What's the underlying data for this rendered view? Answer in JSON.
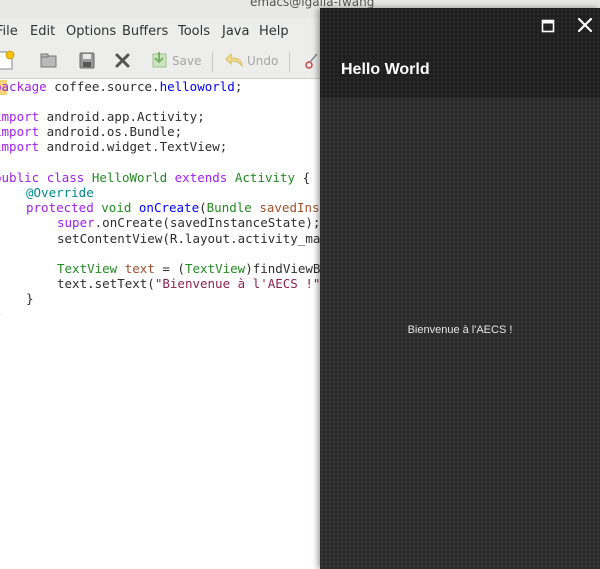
{
  "emacs": {
    "title": "emacs@igalia-fwang",
    "menu": [
      "File",
      "Edit",
      "Options",
      "Buffers",
      "Tools",
      "Java",
      "Help"
    ],
    "toolbar": {
      "save_label": "Save",
      "undo_label": "Undo",
      "icons": [
        "new-file-icon",
        "open-folder-icon",
        "save-disk-icon",
        "close-x-icon",
        "save-icon",
        "undo-icon",
        "cut-icon"
      ]
    },
    "code": {
      "line1": {
        "a": "package",
        "b": " coffee.source.",
        "c": "helloworld",
        "d": ";"
      },
      "line2": {
        "a": "import",
        "b": " android.app.Activity;"
      },
      "line3": {
        "a": "import",
        "b": " android.os.Bundle;"
      },
      "line4": {
        "a": "import",
        "b": " android.widget.TextView;"
      },
      "line5": {
        "a": "public",
        "b": " ",
        "c": "class",
        "d": " ",
        "e": "HelloWorld",
        "f": " ",
        "g": "extends",
        "h": " ",
        "i": "Activity",
        "j": " {"
      },
      "line6": {
        "a": "@Override"
      },
      "line7": {
        "a": "protected",
        "b": " ",
        "c": "void",
        "d": " ",
        "e": "onCreate",
        "f": "(",
        "g": "Bundle",
        "h": " ",
        "i": "savedIns"
      },
      "line8": {
        "a": "super",
        "b": ".onCreate(savedInstanceState);"
      },
      "line9": {
        "a": "setContentView(R.layout.activity_ma"
      },
      "line10": {
        "a": "TextView",
        "b": " ",
        "c": "text",
        "d": " = (",
        "e": "TextView",
        "f": ")findViewB"
      },
      "line11": {
        "a": "text.setText(",
        "b": "\"Bienvenue à l'AECS !\""
      },
      "line12": {
        "a": "}"
      },
      "line13": {
        "a": "}"
      }
    }
  },
  "emulator": {
    "app_title": "Hello World",
    "body_text": "Bienvenue à l'AECS !",
    "icons": [
      "maximize-icon",
      "close-icon"
    ]
  },
  "colors": {
    "keyword": "#a020f0",
    "type": "#228b22",
    "function": "#0000ff",
    "variable": "#a0522d",
    "string": "#8b2252",
    "annotation": "#008b8b",
    "emulator_bg": "#2b2b2b"
  }
}
